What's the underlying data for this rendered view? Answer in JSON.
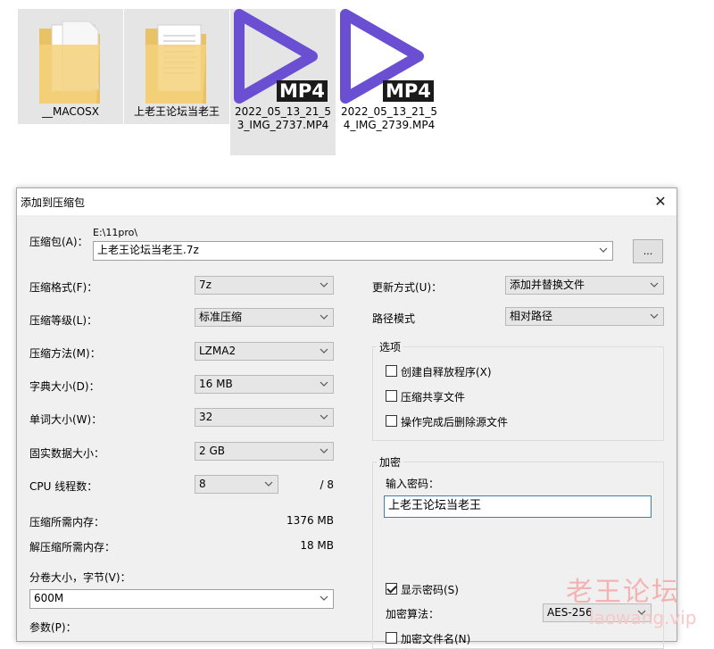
{
  "files": [
    {
      "name": "__MACOSX",
      "icon": "folder-icon"
    },
    {
      "name": "上老王论坛当老王",
      "icon": "folder-icon"
    },
    {
      "name": "2022_05_13_21_53_IMG_2737.MP4",
      "icon": "mp4-video-icon",
      "tag": "MP4"
    },
    {
      "name": "2022_05_13_21_54_IMG_2739.MP4",
      "icon": "mp4-video-icon",
      "tag": "MP4"
    }
  ],
  "dialog": {
    "title": "添加到压缩包",
    "close": "✕",
    "archive": {
      "label": "压缩包(A)：",
      "path": "E:\\11pro\\",
      "value": "上老王论坛当老王.7z",
      "browse": "..."
    },
    "left": {
      "format": {
        "label": "压缩格式(F)：",
        "value": "7z"
      },
      "level": {
        "label": "压缩等级(L)：",
        "value": "标准压缩"
      },
      "method": {
        "label": "压缩方法(M)：",
        "value": "LZMA2"
      },
      "dict": {
        "label": "字典大小(D)：",
        "value": "16 MB"
      },
      "word": {
        "label": "单词大小(W)：",
        "value": "32"
      },
      "solid": {
        "label": "固实数据大小：",
        "value": "2 GB"
      },
      "threads": {
        "label": "CPU 线程数：",
        "value": "8",
        "total": "/ 8"
      },
      "mem_compress": {
        "label": "压缩所需内存：",
        "value": "1376 MB"
      },
      "mem_decompress": {
        "label": "解压缩所需内存：",
        "value": "18 MB"
      },
      "volume": {
        "label": "分卷大小，字节(V)：",
        "value": "600M"
      },
      "params": {
        "label": "参数(P)："
      }
    },
    "right": {
      "update": {
        "label": "更新方式(U)：",
        "value": "添加并替换文件"
      },
      "path_mode": {
        "label": "路径模式",
        "value": "相对路径"
      },
      "options": {
        "title": "选项",
        "sfx": "创建自释放程序(X)",
        "shared": "压缩共享文件",
        "delete": "操作完成后删除源文件"
      },
      "encryption": {
        "title": "加密",
        "password_label": "输入密码：",
        "password_value": "上老王论坛当老王",
        "show_password": "显示密码(S)",
        "method_label": "加密算法：",
        "method_value": "AES-256",
        "encrypt_names": "加密文件名(N)"
      }
    }
  },
  "watermark": {
    "cn": "老王论坛",
    "en": "laowang.vip"
  }
}
